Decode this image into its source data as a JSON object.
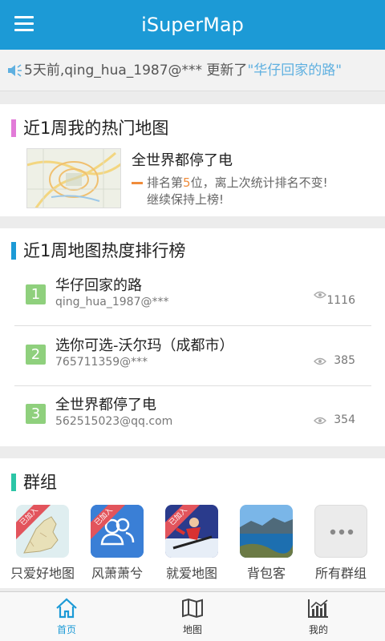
{
  "header": {
    "title": "iSuperMap"
  },
  "news": {
    "prefix": "5天前,qing_hua_1987@*** 更新了",
    "link": "\"华仔回家的路\""
  },
  "hot_map": {
    "section_title": "近1周我的热门地图",
    "map_title": "全世界都停了电",
    "rank_pre": "排名第",
    "rank_num": "5",
    "rank_post": "位，离上次统计排名不变!",
    "rank_line2": "继续保持上榜!"
  },
  "ranking": {
    "section_title": "近1周地图热度排行榜",
    "items": [
      {
        "rank": "1",
        "name": "华仔回家的路",
        "user": "qing_hua_1987@***",
        "views": "1116"
      },
      {
        "rank": "2",
        "name": "选你可选-沃尔玛（成都市）",
        "user": "765711359@***",
        "views": "385"
      },
      {
        "rank": "3",
        "name": "全世界都停了电",
        "user": "562515023@qq.com",
        "views": "354"
      }
    ]
  },
  "groups": {
    "section_title": "群组",
    "joined_badge": "已加入",
    "items": [
      {
        "label": "只爱好地图",
        "icon": "map-icon"
      },
      {
        "label": "风萧萧兮",
        "icon": "people-icon"
      },
      {
        "label": "就爱地图",
        "icon": "skier-icon"
      },
      {
        "label": "背包客",
        "icon": "lake-photo-icon"
      },
      {
        "label": "所有群组",
        "icon": "more-icon"
      }
    ]
  },
  "tabs": [
    {
      "label": "首页",
      "icon": "home-icon"
    },
    {
      "label": "地图",
      "icon": "map-book-icon"
    },
    {
      "label": "我的",
      "icon": "chart-icon"
    }
  ],
  "colors": {
    "primary": "#1c9ad6",
    "rank_badge": "#8fd07d",
    "accent_orange": "#f08c3b",
    "joined_ribbon": "#e2545c",
    "bar_hot": "#e27bd8",
    "bar_rank": "#1c9ad6",
    "bar_group": "#2bc5a6"
  }
}
